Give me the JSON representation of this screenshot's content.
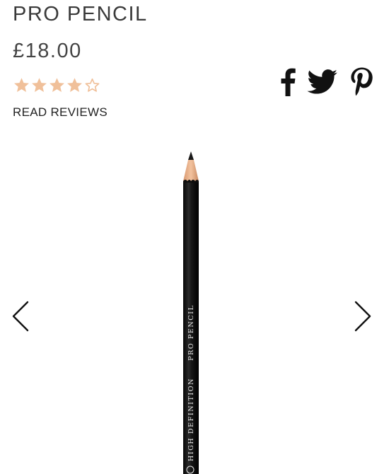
{
  "product": {
    "title": "PRO PENCIL",
    "price": "£18.00",
    "rating": {
      "value": 4,
      "max": 5,
      "color": "#f0c09a"
    },
    "reviews_link": "READ REVIEWS",
    "imprint": {
      "brand": "HIGH DEFINITION",
      "name": "PRO PENCIL"
    }
  },
  "social": {
    "icons": [
      "facebook-icon",
      "twitter-icon",
      "pinterest-icon"
    ],
    "color": "#111111"
  },
  "gallery": {
    "prev_icon": "chevron-left-icon",
    "next_icon": "chevron-right-icon"
  }
}
